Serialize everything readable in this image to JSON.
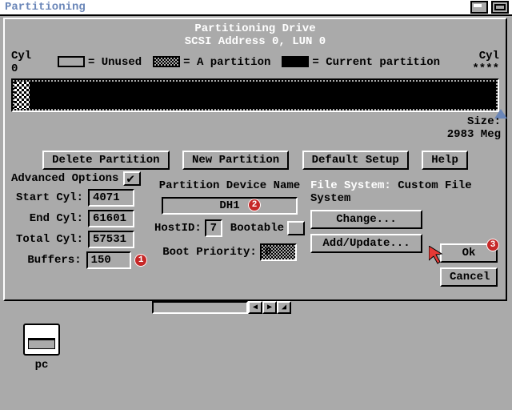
{
  "wb": {
    "title": "Partitioning",
    "icon1": "depth-gadget",
    "icon2": "zoom-gadget"
  },
  "header": {
    "title": "Partitioning Drive",
    "subtitle": "SCSI Address 0, LUN 0"
  },
  "cyl": {
    "label": "Cyl",
    "left": "0",
    "right": "****"
  },
  "legend": {
    "unused": "= Unused",
    "apart": "= A partition",
    "current": "= Current partition"
  },
  "size": {
    "label": "Size:",
    "value": "2983 Meg"
  },
  "buttons": {
    "delete": "Delete Partition",
    "new": "New Partition",
    "default": "Default Setup",
    "help": "Help"
  },
  "advanced": {
    "label": "Advanced Options",
    "checked": true
  },
  "fields": {
    "start_label": "Start Cyl:",
    "start": "4071",
    "end_label": "End Cyl:",
    "end": "61601",
    "total_label": "Total Cyl:",
    "total": "57531",
    "buffers_label": "Buffers:",
    "buffers": "150"
  },
  "device": {
    "heading": "Partition Device Name",
    "name": "DH1",
    "hostid_label": "HostID:",
    "hostid": "7",
    "bootable_label": "Bootable",
    "bootprio_label": "Boot Priority:",
    "bootprio": "0"
  },
  "fs": {
    "label": "File System:",
    "value": "Custom File System",
    "change": "Change...",
    "addupdate": "Add/Update..."
  },
  "okcancel": {
    "ok": "Ok",
    "cancel": "Cancel"
  },
  "markers": {
    "m1": "1",
    "m2": "2",
    "m3": "3"
  },
  "desktop": {
    "pc_label": "pc"
  }
}
